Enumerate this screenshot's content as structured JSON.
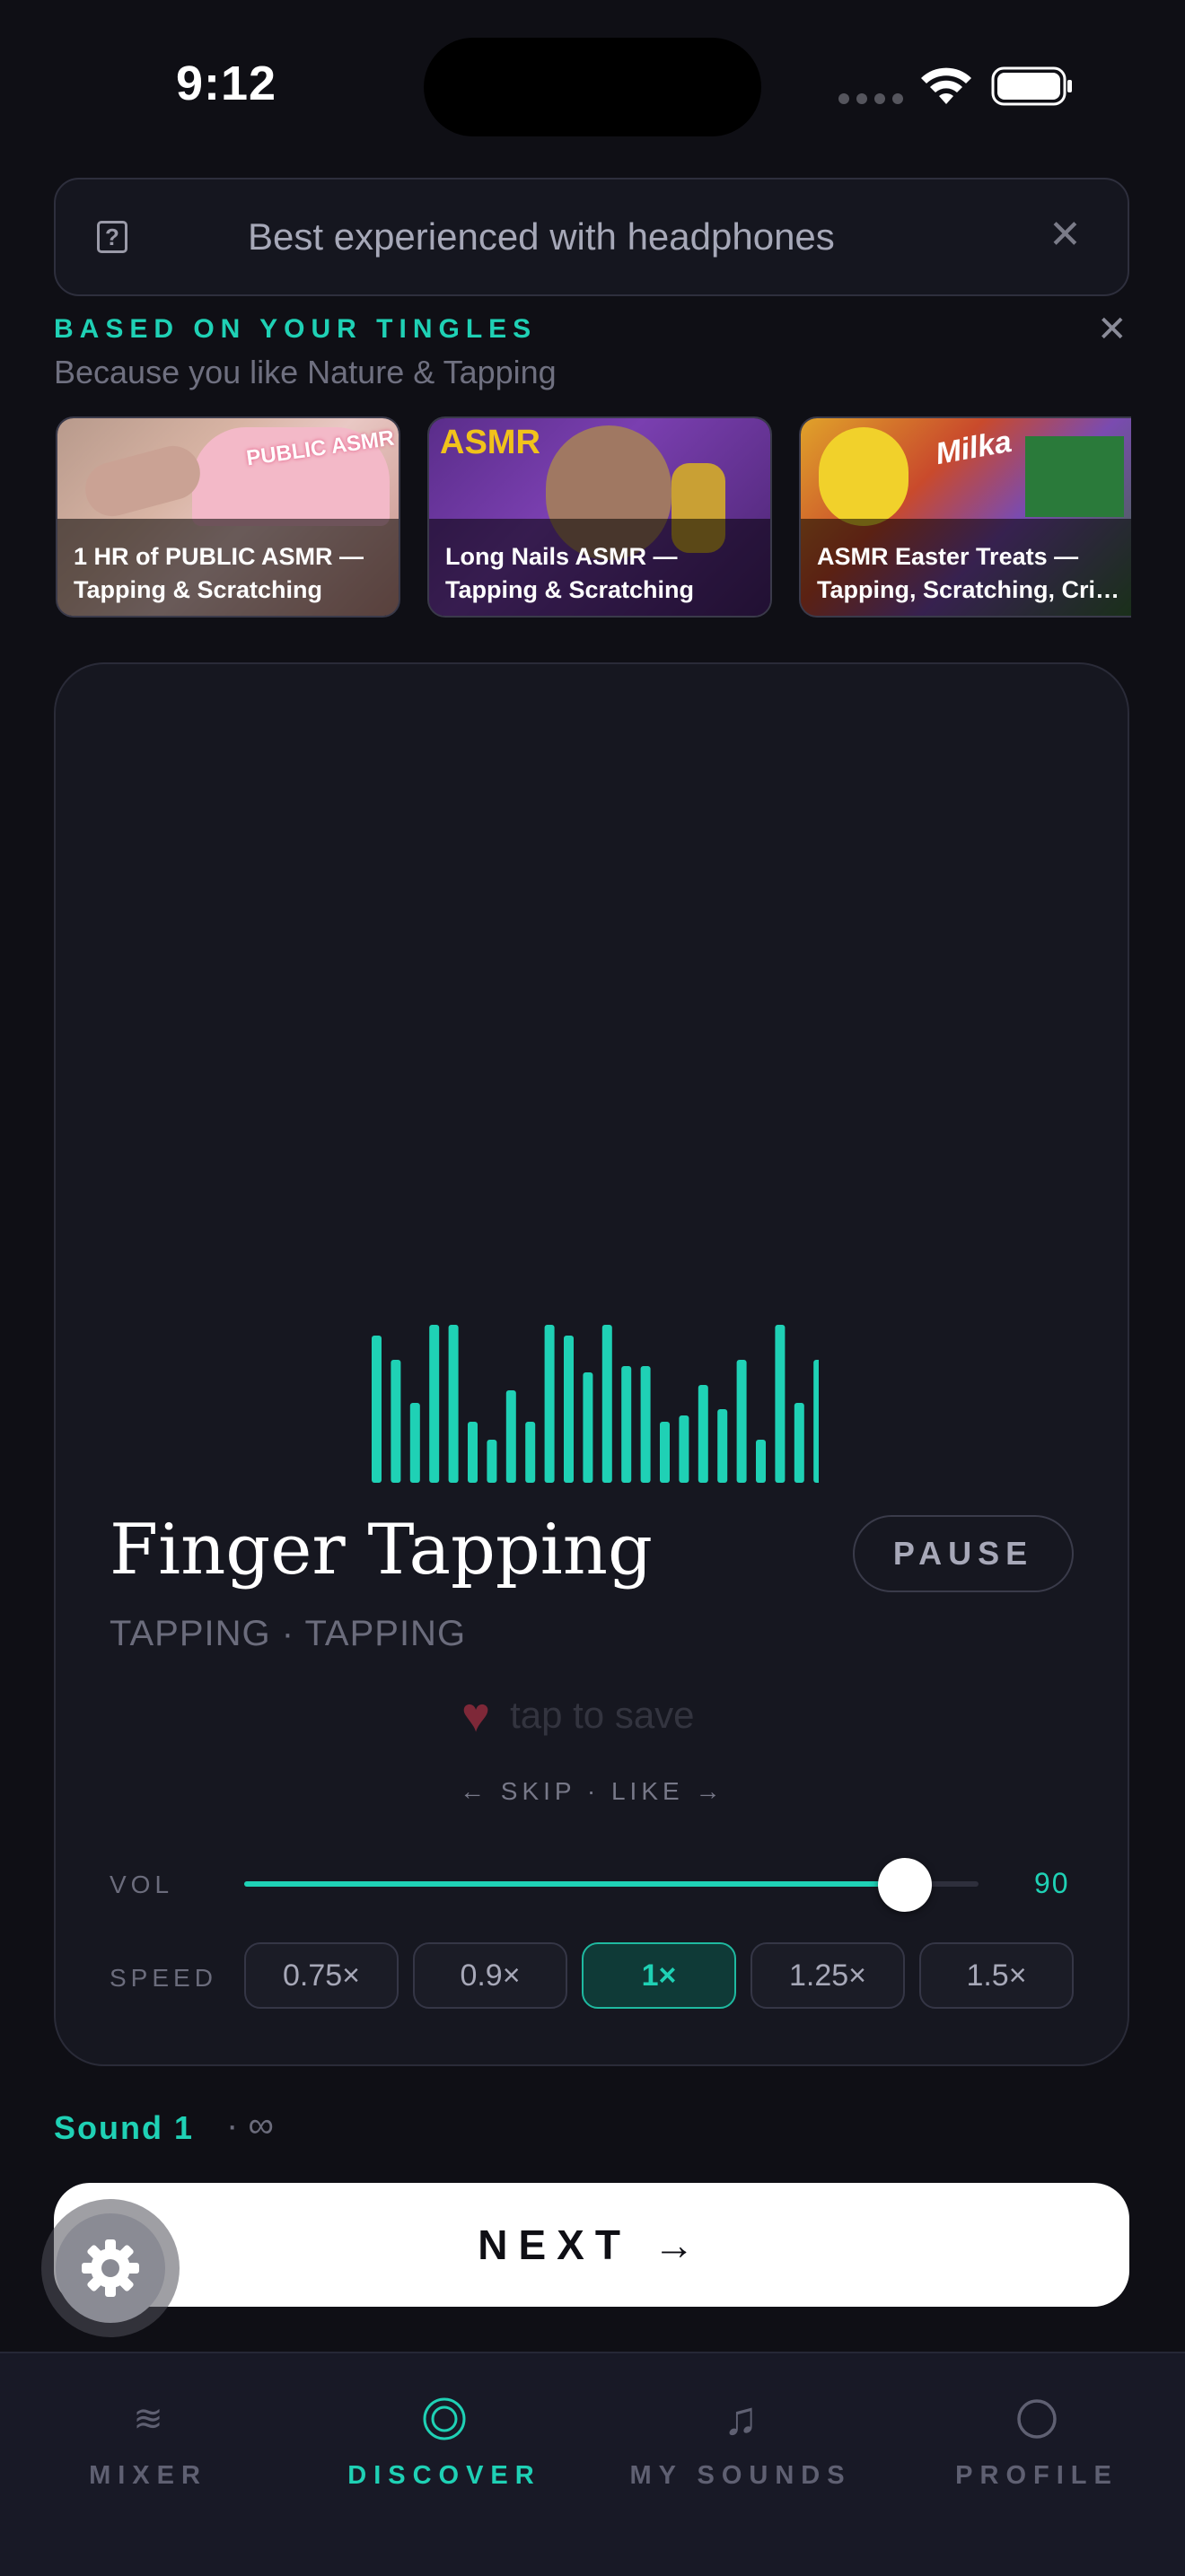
{
  "status_bar": {
    "time": "9:12"
  },
  "banner": {
    "text": "Best experienced with headphones",
    "help_icon": "question-icon",
    "close_icon": "close-icon"
  },
  "recommendations": {
    "title": "BASED ON YOUR TINGLES",
    "subtitle": "Because you like Nature & Tapping",
    "cards": [
      {
        "title_line1": "1 HR of PUBLIC ASMR —",
        "title_line2": "Tapping & Scratching",
        "badge": "PUBLIC ASMR"
      },
      {
        "title_line1": "Long Nails ASMR —",
        "title_line2": "Tapping & Scratching",
        "badge": "ASMR"
      },
      {
        "title_line1": "ASMR Easter Treats —",
        "title_line2": "Tapping, Scratching, Cri…",
        "badge": "Milka"
      }
    ]
  },
  "player": {
    "title": "Finger Tapping",
    "tags": "TAPPING · TAPPING",
    "pause_label": "PAUSE",
    "save_text": "tap to save",
    "skip_like": "← SKIP · LIKE →",
    "volume": {
      "label": "VOL",
      "value": 90
    },
    "speed": {
      "label": "SPEED",
      "options": [
        "0.75×",
        "0.9×",
        "1×",
        "1.25×",
        "1.5×"
      ],
      "selected": "1×"
    }
  },
  "sound_label": "Sound 1",
  "sound_repeat": "· ∞",
  "next_label": "NEXT →",
  "tabs": [
    {
      "label": "MIXER",
      "icon": "wave-icon",
      "active": false
    },
    {
      "label": "DISCOVER",
      "icon": "target-icon",
      "active": true
    },
    {
      "label": "MY SOUNDS",
      "icon": "music-note-icon",
      "active": false
    },
    {
      "label": "PROFILE",
      "icon": "circle-icon",
      "active": false
    }
  ],
  "colors": {
    "accent": "#1fd1b5",
    "background": "#0f0f15",
    "card": "#161720"
  }
}
